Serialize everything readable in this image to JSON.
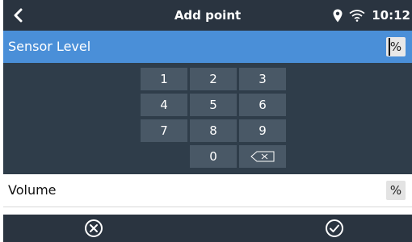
{
  "header": {
    "title": "Add point",
    "time": "10:12",
    "back_icon": "chevron-left-icon",
    "location_icon": "location-pin-icon",
    "wifi_icon": "wifi-icon"
  },
  "sensor": {
    "label": "Sensor Level",
    "unit": "%"
  },
  "keypad": {
    "keys": [
      "1",
      "2",
      "3",
      "4",
      "5",
      "6",
      "7",
      "8",
      "9",
      "0"
    ],
    "backspace_icon": "backspace-icon"
  },
  "volume": {
    "label": "Volume",
    "unit": "%"
  },
  "footer": {
    "cancel_icon": "cancel-circle-icon",
    "confirm_icon": "check-circle-icon"
  },
  "colors": {
    "header_bg": "#2a3440",
    "selected_row": "#4a8fd8",
    "keypad_bg": "#2f3d4a",
    "key_bg": "#495866"
  }
}
